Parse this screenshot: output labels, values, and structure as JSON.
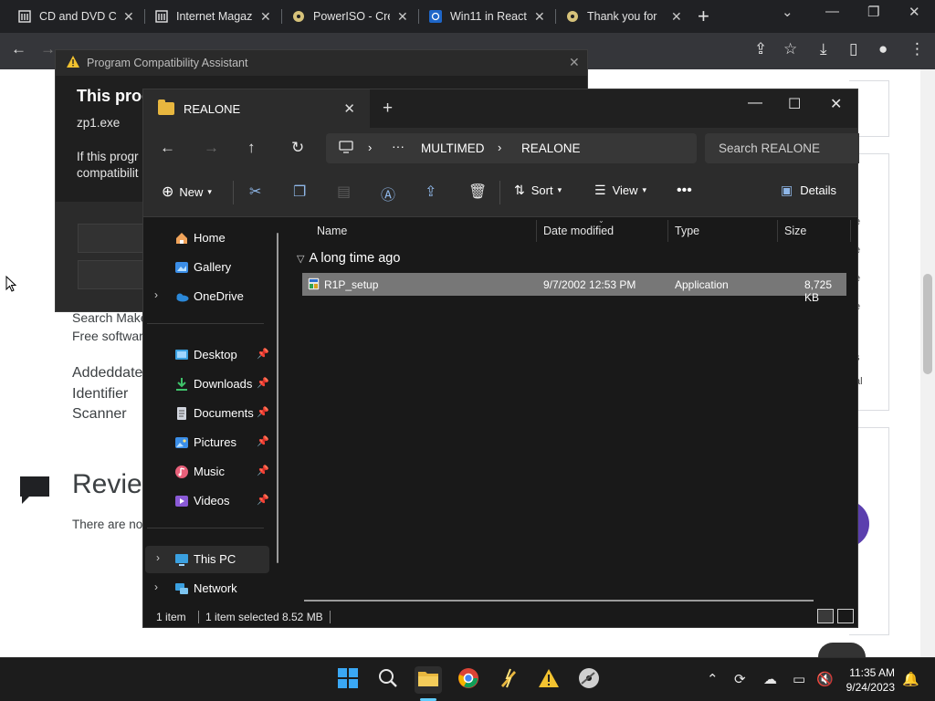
{
  "browser": {
    "tabs": [
      {
        "title": "CD and DVD Co",
        "icon": "archive-icon"
      },
      {
        "title": "Internet Magazi",
        "icon": "archive-icon"
      },
      {
        "title": "PowerISO - Cre",
        "icon": "disc-icon"
      },
      {
        "title": "Win11 in React",
        "icon": "react-icon"
      },
      {
        "title": "Thank you for",
        "icon": "disc-icon"
      }
    ],
    "new_tab_glyph": "+",
    "close_glyph": "✕"
  },
  "webpage": {
    "lines": [
      "Search Make",
      "Free softwar"
    ],
    "meta_lines": [
      "Addeddate",
      "Identifier",
      "Scanner"
    ],
    "review_heading": "Revie",
    "review_text": "There are no",
    "right_letters": [
      "e",
      "e",
      "e",
      "e",
      "s",
      "al"
    ]
  },
  "compat_dialog": {
    "title": "Program Compatibility Assistant",
    "heading": "This prog",
    "file": "zp1.exe",
    "message": "If this progr compatibilit"
  },
  "explorer": {
    "tab_title": "REALONE",
    "breadcrumb": [
      "MULTIMED",
      "REALONE"
    ],
    "search_placeholder": "Search REALONE",
    "commands": {
      "new": "New",
      "sort": "Sort",
      "view": "View",
      "details": "Details"
    },
    "nav": {
      "pinned_top": [
        {
          "label": "Home",
          "icon": "home-icon"
        },
        {
          "label": "Gallery",
          "icon": "gallery-icon"
        },
        {
          "label": "OneDrive",
          "icon": "cloud-icon"
        }
      ],
      "quick": [
        {
          "label": "Desktop",
          "icon": "desktop-icon"
        },
        {
          "label": "Downloads",
          "icon": "download-icon"
        },
        {
          "label": "Documents",
          "icon": "document-icon"
        },
        {
          "label": "Pictures",
          "icon": "picture-icon"
        },
        {
          "label": "Music",
          "icon": "music-icon"
        },
        {
          "label": "Videos",
          "icon": "video-icon"
        }
      ],
      "bottom": [
        {
          "label": "This PC",
          "icon": "pc-icon"
        },
        {
          "label": "Network",
          "icon": "network-icon"
        }
      ]
    },
    "columns": [
      "Name",
      "Date modified",
      "Type",
      "Size"
    ],
    "group": "A long time ago",
    "files": [
      {
        "name": "R1P_setup",
        "date": "9/7/2002 12:53 PM",
        "type": "Application",
        "size": "8,725 KB"
      }
    ],
    "status": {
      "count": "1 item",
      "selected": "1 item selected",
      "size": "8.52 MB"
    }
  },
  "taskbar": {
    "time": "11:35 AM",
    "date": "9/24/2023"
  },
  "colors": {
    "accent": "#60cdff",
    "folder": "#e8b73f",
    "selection": "#777777"
  }
}
